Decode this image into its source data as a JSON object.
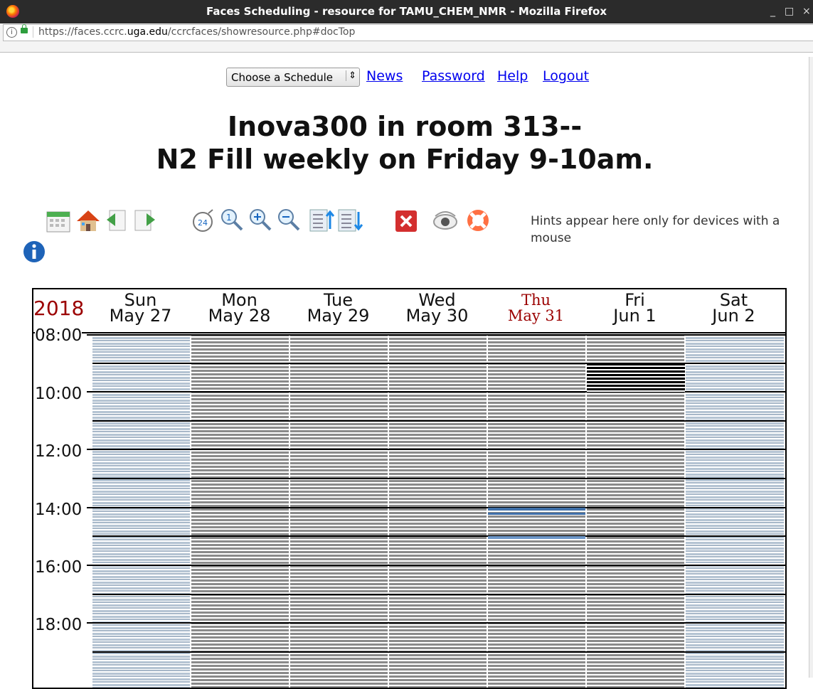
{
  "window": {
    "title": "Faces Scheduling - resource for TAMU_CHEM_NMR - Mozilla Firefox",
    "min": "_",
    "max": "□",
    "close": "×"
  },
  "urlbar": {
    "info": "ⓘ",
    "url_pre": "https://faces.ccrc.",
    "url_domain": "uga.edu",
    "url_post": "/ccrcfaces/showresource.php#docTop"
  },
  "nav": {
    "schedule_select": "Choose a Schedule",
    "links": [
      "News",
      "Password",
      "Help",
      "Logout"
    ]
  },
  "heading": {
    "line1": "Inova300 in room 313--",
    "line2": "N2 Fill weekly on Friday 9-10am."
  },
  "toolbar": {
    "icons": [
      "calendar-icon",
      "home-icon",
      "previous-week-icon",
      "next-week-icon",
      "24-hour-icon",
      "zoom-reset-icon",
      "zoom-in-icon",
      "zoom-out-icon",
      "scroll-up-icon",
      "scroll-down-icon",
      "close-icon",
      "view-icon",
      "help-lifebuoy-icon",
      "info-icon"
    ],
    "hint": "Hints appear here only for devices with a mouse"
  },
  "calendar": {
    "year": "2018",
    "days": [
      {
        "dow": "Sun",
        "date": "May 27",
        "weekend": true
      },
      {
        "dow": "Mon",
        "date": "May 28",
        "weekend": false
      },
      {
        "dow": "Tue",
        "date": "May 29",
        "weekend": false
      },
      {
        "dow": "Wed",
        "date": "May 30",
        "weekend": false
      },
      {
        "dow": "Thu",
        "date": "May 31",
        "weekend": false,
        "today": true
      },
      {
        "dow": "Fri",
        "date": "Jun 1",
        "weekend": false
      },
      {
        "dow": "Sat",
        "date": "Jun 2",
        "weekend": true
      }
    ],
    "times": [
      "08:00",
      "10:00",
      "12:00",
      "14:00",
      "16:00",
      "18:00"
    ],
    "colors": {
      "weekend": "#a7b7c8",
      "weekday": "#8a8a8a",
      "booked": "#000000",
      "thu_block": "#4a76a8",
      "today": "#9b0000"
    }
  }
}
